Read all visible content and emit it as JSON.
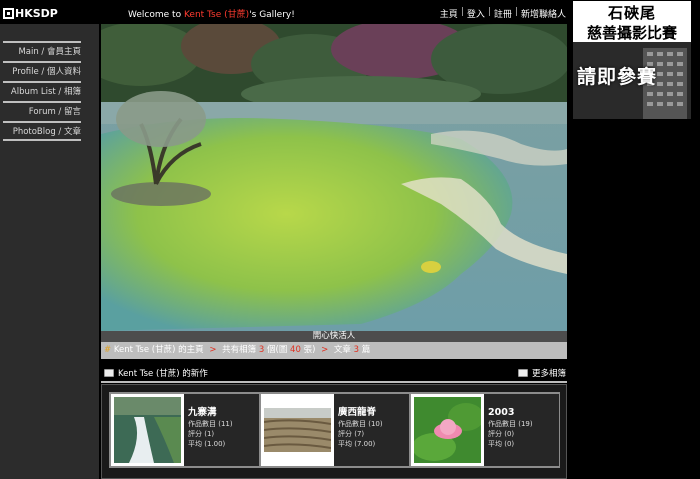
{
  "header": {
    "logo_text": "HKSDP",
    "welcome_prefix": "Welcome",
    "welcome_to": "to",
    "user_name": "Kent Tse (甘蔗)",
    "welcome_suffix": "'s Gallery!",
    "nav": [
      "主頁",
      "登入",
      "註冊",
      "新增聯絡人"
    ]
  },
  "sidebar": {
    "items": [
      {
        "label": "Main / 會員主頁"
      },
      {
        "label": "Profile / 個人資料"
      },
      {
        "label": "Album List / 相簿"
      },
      {
        "label": "Forum / 留言"
      },
      {
        "label": "PhotoBlog / 文章"
      }
    ]
  },
  "photo": {
    "caption": "開心快活人"
  },
  "info_bar": {
    "owner_home": "Kent Tse (甘蔗) 的主頁",
    "albums_prefix": "共有相簿",
    "albums_count": "3",
    "albums_mid": "個(圖",
    "photos_count": "40",
    "albums_suffix": "張)",
    "articles_label": "文章",
    "articles_count": "3",
    "articles_suffix": "篇"
  },
  "new_works": {
    "title": "Kent Tse (甘蔗) 的新作",
    "more": "更多相簿",
    "cards": [
      {
        "title": "九寨溝",
        "works": "作品數目 (11)",
        "score": "評分 (1)",
        "average": "平均 (1.00)",
        "icon": "waterfall-thumbnail"
      },
      {
        "title": "廣西龍脊",
        "works": "作品數目 (10)",
        "score": "評分 (7)",
        "average": "平均 (7.00)",
        "icon": "rice-terrace-thumbnail"
      },
      {
        "title": "2003",
        "works": "作品數目 (19)",
        "score": "評分 (0)",
        "average": "平均 (0)",
        "icon": "lotus-thumbnail"
      }
    ]
  },
  "ad": {
    "line1": "石硤尾",
    "line2": "慈善攝影比賽",
    "cta": "請即參賽"
  },
  "colors": {
    "accent_red": "#e03020",
    "name_red": "#ff3b2f",
    "sidebar_bg": "#2c2c2c",
    "info_bar_bg": "#bdbdbd"
  }
}
